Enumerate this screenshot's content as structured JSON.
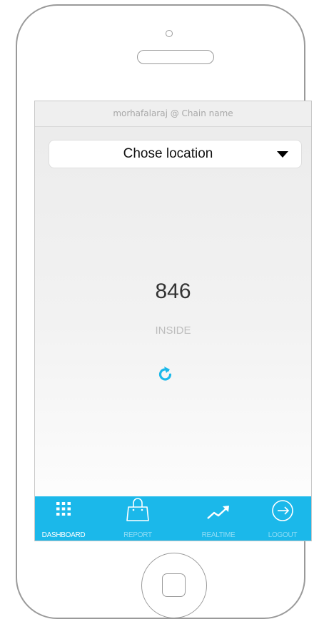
{
  "header": {
    "user_line": "morhafalaraj @ Chain name"
  },
  "location": {
    "selected": "Chose location"
  },
  "stats": {
    "count": "846",
    "label": "INSIDE"
  },
  "tabs": [
    {
      "label": "DASHBOARD",
      "icon": "grid-icon",
      "active": true
    },
    {
      "label": "REPORT",
      "icon": "shopping-bag-icon",
      "active": false
    },
    {
      "label": "REALTIME",
      "icon": "trend-up-icon",
      "active": false
    },
    {
      "label": "LOGOUT",
      "icon": "logout-icon",
      "active": false
    }
  ],
  "colors": {
    "accent": "#1bb8ea",
    "refresh_icon": "#1bb8ea",
    "tab_inactive_label": "#8fdcf5"
  }
}
